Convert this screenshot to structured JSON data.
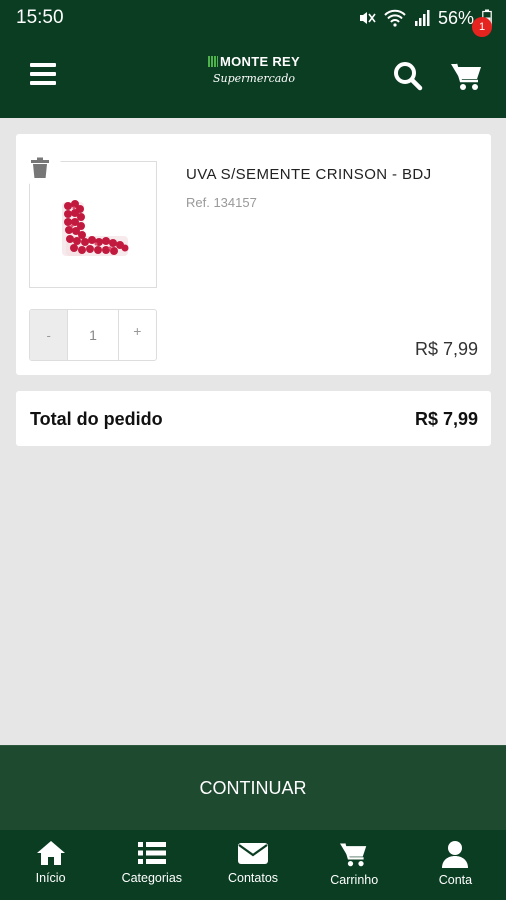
{
  "status_bar": {
    "time": "15:50",
    "battery": "56%"
  },
  "header": {
    "logo_brand": "MONTE REY",
    "logo_sub": "Supermercado",
    "cart_count": "1"
  },
  "cart_item": {
    "name": "UVA S/SEMENTE CRINSON - BDJ",
    "ref": "Ref. 134157",
    "quantity": "1",
    "minus_label": "-",
    "plus_label": "+",
    "price": "R$ 7,99"
  },
  "order_total": {
    "label": "Total do pedido",
    "value": "R$ 7,99"
  },
  "continue_label": "CONTINUAR",
  "bottom_nav": [
    {
      "label": "Início",
      "icon": "home-icon"
    },
    {
      "label": "Categorias",
      "icon": "list-icon"
    },
    {
      "label": "Contatos",
      "icon": "envelope-icon"
    },
    {
      "label": "Carrinho",
      "icon": "cart-icon"
    },
    {
      "label": "Conta",
      "icon": "user-icon"
    }
  ],
  "colors": {
    "brand_green": "#0b3d22",
    "continue_green": "#1e4a30",
    "badge_red": "#e52420",
    "background": "#e6e6e6"
  }
}
